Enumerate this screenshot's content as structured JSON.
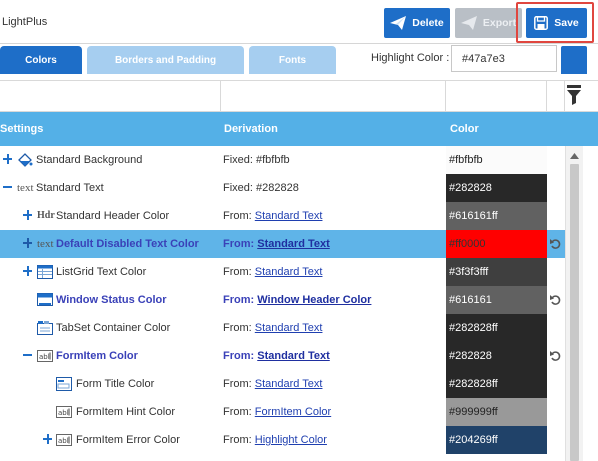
{
  "app": {
    "title": "LightPlus"
  },
  "toolbar": {
    "delete_label": "Delete",
    "export_label": "Export",
    "save_label": "Save"
  },
  "tabs": [
    {
      "label": "Colors",
      "active": true
    },
    {
      "label": "Borders and Padding",
      "active": false
    },
    {
      "label": "Fonts",
      "active": false
    }
  ],
  "highlight": {
    "label": "Highlight Color :",
    "value": "#47a7e3"
  },
  "grid": {
    "columns": [
      "Settings",
      "Derivation",
      "Color"
    ],
    "rows": [
      {
        "expander": "plus",
        "icon": "paint-bucket-icon",
        "name": "Standard Background",
        "bold": false,
        "deriv_prefix": "Fixed: #fbfbfb",
        "deriv_link": "",
        "color_text": "#fbfbfb",
        "swatch": "#fbfbfb",
        "text_color": "#222222",
        "reset": false,
        "selected": false,
        "indent": 0
      },
      {
        "expander": "minus",
        "icon": "text-icon",
        "icon_text": "text",
        "name": "Standard Text",
        "bold": false,
        "deriv_prefix": "Fixed: #282828",
        "deriv_link": "",
        "color_text": "#282828",
        "swatch": "#282828",
        "text_color": "#ffffff",
        "reset": false,
        "selected": false,
        "indent": 0
      },
      {
        "expander": "plus",
        "icon": "header-icon",
        "icon_text": "Hdr",
        "name": "Standard Header Color",
        "bold": false,
        "deriv_prefix": "From: ",
        "deriv_link": "Standard Text",
        "color_text": "#616161ff",
        "swatch": "#616161",
        "text_color": "#ffffff",
        "reset": false,
        "selected": false,
        "indent": 1
      },
      {
        "expander": "plus",
        "icon": "text-icon",
        "icon_text": "text",
        "name": "Default Disabled Text Color",
        "bold": true,
        "deriv_prefix": "From: ",
        "deriv_link": "Standard Text",
        "color_text": "#ff0000",
        "swatch": "#ff0000",
        "text_color": "#333333",
        "reset": true,
        "selected": true,
        "indent": 1
      },
      {
        "expander": "plus",
        "icon": "listgrid-icon",
        "name": "ListGrid Text Color",
        "bold": false,
        "deriv_prefix": "From: ",
        "deriv_link": "Standard Text",
        "color_text": "#3f3f3fff",
        "swatch": "#3f3f3f",
        "text_color": "#ffffff",
        "reset": false,
        "selected": false,
        "indent": 1
      },
      {
        "expander": "none",
        "icon": "window-icon",
        "name": "Window Status Color",
        "bold": true,
        "deriv_prefix": "From: ",
        "deriv_link": "Window Header Color",
        "color_text": "#616161",
        "swatch": "#616161",
        "text_color": "#ffffff",
        "reset": true,
        "selected": false,
        "indent": 1
      },
      {
        "expander": "none",
        "icon": "tabset-icon",
        "name": "TabSet Container Color",
        "bold": false,
        "deriv_prefix": "From: ",
        "deriv_link": "Standard Text",
        "color_text": "#282828ff",
        "swatch": "#282828",
        "text_color": "#ffffff",
        "reset": false,
        "selected": false,
        "indent": 1
      },
      {
        "expander": "minus",
        "icon": "formitem-icon",
        "name": "FormItem Color",
        "bold": true,
        "deriv_prefix": "From: ",
        "deriv_link": "Standard Text",
        "color_text": "#282828",
        "swatch": "#282828",
        "text_color": "#ffffff",
        "reset": true,
        "selected": false,
        "indent": 1
      },
      {
        "expander": "none",
        "icon": "form-title-icon",
        "name": "Form Title Color",
        "bold": false,
        "deriv_prefix": "From: ",
        "deriv_link": "Standard Text",
        "color_text": "#282828ff",
        "swatch": "#282828",
        "text_color": "#ffffff",
        "reset": false,
        "selected": false,
        "indent": 2
      },
      {
        "expander": "none",
        "icon": "formitem-icon",
        "name": "FormItem Hint Color",
        "bold": false,
        "deriv_prefix": "From: ",
        "deriv_link": "FormItem Color",
        "color_text": "#999999ff",
        "swatch": "#999999",
        "text_color": "#222222",
        "reset": false,
        "selected": false,
        "indent": 2
      },
      {
        "expander": "plus",
        "icon": "formitem-icon",
        "name": "FormItem Error Color",
        "bold": false,
        "deriv_prefix": "From: ",
        "deriv_link": "Highlight Color",
        "color_text": "#204269ff",
        "swatch": "#204269",
        "text_color": "#ffffff",
        "reset": false,
        "selected": false,
        "indent": 2
      }
    ]
  }
}
